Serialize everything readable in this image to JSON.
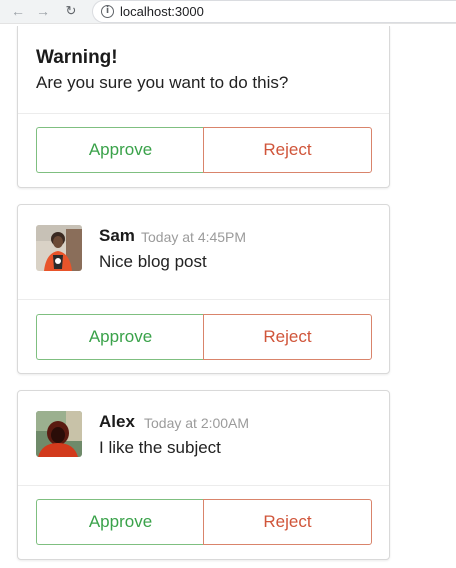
{
  "browser": {
    "url": "localhost:3000",
    "back_glyph": "←",
    "forward_glyph": "→",
    "reload_glyph": "↻",
    "info_glyph": "i"
  },
  "warning_card": {
    "title": "Warning!",
    "message": "Are you sure you want to do this?",
    "approve_label": "Approve",
    "reject_label": "Reject"
  },
  "comments": [
    {
      "author": "Sam",
      "timestamp": "Today at 4:45PM",
      "text": "Nice blog post",
      "approve_label": "Approve",
      "reject_label": "Reject"
    },
    {
      "author": "Alex",
      "timestamp": "Today at 2:00AM",
      "text": "I like the subject",
      "approve_label": "Approve",
      "reject_label": "Reject"
    }
  ],
  "colors": {
    "approve": "#3aa24a",
    "approve_border": "#7fbf80",
    "reject": "#d0553a",
    "reject_border": "#d9846b",
    "meta_text": "#9b9b9b"
  }
}
